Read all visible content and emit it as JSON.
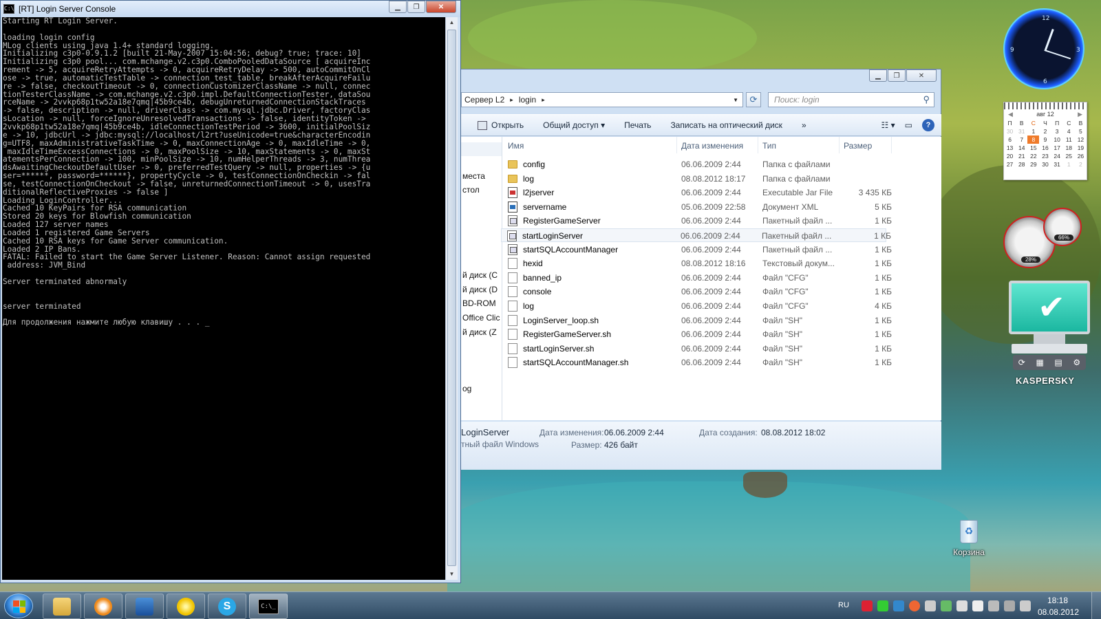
{
  "console": {
    "title": "[RT] Login Server Console",
    "icon_label": "C:\\",
    "lines": [
      "Starting RT Login Server.",
      "",
      "loading login config",
      "MLog clients using java 1.4+ standard logging.",
      "Initializing c3p0-0.9.1.2 [built 21-May-2007 15:04:56; debug? true; trace: 10]",
      "Initializing c3p0 pool... com.mchange.v2.c3p0.ComboPooledDataSource [ acquireInc",
      "rement -> 5, acquireRetryAttempts -> 0, acquireRetryDelay -> 500, autoCommitOnCl",
      "ose -> true, automaticTestTable -> connection_test_table, breakAfterAcquireFailu",
      "re -> false, checkoutTimeout -> 0, connectionCustomizerClassName -> null, connec",
      "tionTesterClassName -> com.mchange.v2.c3p0.impl.DefaultConnectionTester, dataSou",
      "rceName -> 2vvkp68p1tw52a18e7qmq|45b9ce4b, debugUnreturnedConnectionStackTraces",
      "-> false, description -> null, driverClass -> com.mysql.jdbc.Driver, factoryClas",
      "sLocation -> null, forceIgnoreUnresolvedTransactions -> false, identityToken ->",
      "2vvkp68p1tw52a18e7qmq|45b9ce4b, idleConnectionTestPeriod -> 3600, initialPoolSiz",
      "e -> 10, jdbcUrl -> jdbc:mysql://localhost/l2rt?useUnicode=true&characterEncodin",
      "g=UTF8, maxAdministrativeTaskTime -> 0, maxConnectionAge -> 0, maxIdleTime -> 0,",
      " maxIdleTimeExcessConnections -> 0, maxPoolSize -> 10, maxStatements -> 0, maxSt",
      "atementsPerConnection -> 100, minPoolSize -> 10, numHelperThreads -> 3, numThrea",
      "dsAwaitingCheckoutDefaultUser -> 0, preferredTestQuery -> null, properties -> {u",
      "ser=******, password=******}, propertyCycle -> 0, testConnectionOnCheckin -> fal",
      "se, testConnectionOnCheckout -> false, unreturnedConnectionTimeout -> 0, usesTra",
      "ditionalReflectiveProxies -> false ]",
      "Loading LoginController...",
      "Cached 10 KeyPairs for RSA communication",
      "Stored 20 keys for Blowfish communication",
      "Loaded 127 server names",
      "Loaded 1 registered Game Servers",
      "Cached 10 RSA keys for Game Server communication.",
      "Loaded 2 IP Bans.",
      "FATAL: Failed to start the Game Server Listener. Reason: Cannot assign requested",
      " address: JVM_Bind",
      "",
      "Server terminated abnormaly",
      "",
      "",
      "server terminated",
      "",
      "Для продолжения нажмите любую клавишу . . . _"
    ]
  },
  "explorer": {
    "address": {
      "crumbs": [
        "Сервер L2",
        "login"
      ],
      "sep": "▸"
    },
    "search_placeholder": "Поиск: login",
    "toolbar": {
      "open": "Открыть",
      "share": "Общий доступ ▾",
      "print": "Печать",
      "burn": "Записать на оптический диск",
      "more": "»"
    },
    "nav_items": [
      "места",
      "стол",
      "й диск (C",
      "й диск (D",
      "BD-ROM",
      "Office Clic",
      "й диск (Z",
      "og"
    ],
    "columns": {
      "name": "Имя",
      "date": "Дата изменения",
      "type": "Тип",
      "size": "Размер"
    },
    "files": [
      {
        "icon": "folder",
        "name": "config",
        "date": "06.06.2009 2:44",
        "type": "Папка с файлами",
        "size": ""
      },
      {
        "icon": "folder",
        "name": "log",
        "date": "08.08.2012 18:17",
        "type": "Папка с файлами",
        "size": ""
      },
      {
        "icon": "jar",
        "name": "l2jserver",
        "date": "06.06.2009 2:44",
        "type": "Executable Jar File",
        "size": "3 435 КБ"
      },
      {
        "icon": "xml",
        "name": "servername",
        "date": "05.06.2009 22:58",
        "type": "Документ XML",
        "size": "5 КБ"
      },
      {
        "icon": "bat",
        "name": "RegisterGameServer",
        "date": "06.06.2009 2:44",
        "type": "Пакетный файл ...",
        "size": "1 КБ"
      },
      {
        "icon": "bat",
        "name": "startLoginServer",
        "date": "06.06.2009 2:44",
        "type": "Пакетный файл ...",
        "size": "1 КБ"
      },
      {
        "icon": "bat",
        "name": "startSQLAccountManager",
        "date": "06.06.2009 2:44",
        "type": "Пакетный файл ...",
        "size": "1 КБ"
      },
      {
        "icon": "doc",
        "name": "hexid",
        "date": "08.08.2012 18:16",
        "type": "Текстовый докум...",
        "size": "1 КБ"
      },
      {
        "icon": "doc",
        "name": "banned_ip",
        "date": "06.06.2009 2:44",
        "type": "Файл \"CFG\"",
        "size": "1 КБ"
      },
      {
        "icon": "doc",
        "name": "console",
        "date": "06.06.2009 2:44",
        "type": "Файл \"CFG\"",
        "size": "1 КБ"
      },
      {
        "icon": "doc",
        "name": "log",
        "date": "06.06.2009 2:44",
        "type": "Файл \"CFG\"",
        "size": "4 КБ"
      },
      {
        "icon": "doc",
        "name": "LoginServer_loop.sh",
        "date": "06.06.2009 2:44",
        "type": "Файл \"SH\"",
        "size": "1 КБ"
      },
      {
        "icon": "doc",
        "name": "RegisterGameServer.sh",
        "date": "06.06.2009 2:44",
        "type": "Файл \"SH\"",
        "size": "1 КБ"
      },
      {
        "icon": "doc",
        "name": "startLoginServer.sh",
        "date": "06.06.2009 2:44",
        "type": "Файл \"SH\"",
        "size": "1 КБ"
      },
      {
        "icon": "doc",
        "name": "startSQLAccountManager.sh",
        "date": "06.06.2009 2:44",
        "type": "Файл \"SH\"",
        "size": "1 КБ"
      }
    ],
    "selected_index": 5,
    "details": {
      "name": "LoginServer",
      "kind": "тный файл Windows",
      "modified_label": "Дата изменения:",
      "modified_value": "06.06.2009 2:44",
      "size_label": "Размер:",
      "size_value": "426 байт",
      "created_label": "Дата создания:",
      "created_value": "08.08.2012 18:02"
    }
  },
  "gadgets": {
    "calendar": {
      "month": "авг 12",
      "weekdays": [
        "П",
        "В",
        "С",
        "Ч",
        "П",
        "С",
        "В"
      ],
      "weeks": [
        [
          "30",
          "31",
          "1",
          "2",
          "3",
          "4",
          "5"
        ],
        [
          "6",
          "7",
          "8",
          "9",
          "10",
          "11",
          "12"
        ],
        [
          "13",
          "14",
          "15",
          "16",
          "17",
          "18",
          "19"
        ],
        [
          "20",
          "21",
          "22",
          "23",
          "24",
          "25",
          "26"
        ],
        [
          "27",
          "28",
          "29",
          "30",
          "31",
          "1",
          "2"
        ]
      ],
      "today": "8"
    },
    "cpu_percent": "28%",
    "mem_percent": "66%",
    "kaspersky_brand": "KASPERSKY"
  },
  "desktop": {
    "recycle_bin": "Корзина"
  },
  "taskbar": {
    "lang": "RU",
    "time": "18:18",
    "date": "08.08.2012"
  },
  "colors": {
    "accent": "#3a8be0",
    "console_bg": "#000000",
    "console_fg": "#c0c0c0",
    "calendar_today": "#ef7a2a"
  }
}
